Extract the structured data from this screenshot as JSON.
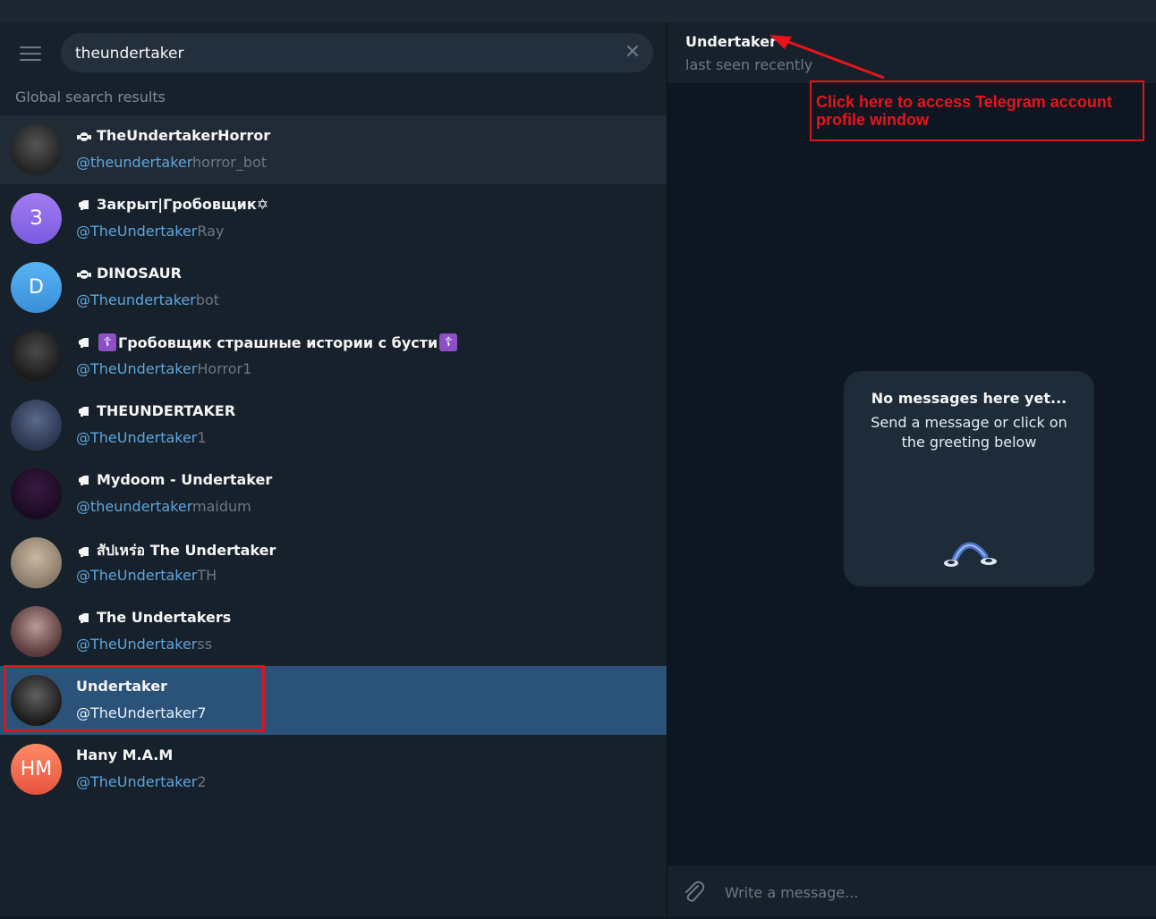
{
  "search": {
    "value": "theundertaker",
    "clear_label": "✕"
  },
  "section_label": "Global search results",
  "results": [
    {
      "title": "TheUndertakerHorror",
      "kind": "bot",
      "handle_match": "@theundertaker",
      "handle_rest": "horror_bot",
      "avatar_type": "photo",
      "avatar_colors": [
        "#222",
        "#555"
      ]
    },
    {
      "title": "Закрыт|Гробовщик✡",
      "kind": "channel",
      "handle_match": "@TheUndertaker",
      "handle_rest": "Ray",
      "avatar_type": "letter",
      "avatar_letter": "З",
      "avatar_colors": [
        "#a17cf0",
        "#7b5be0"
      ]
    },
    {
      "title": "DINOSAUR",
      "kind": "bot",
      "handle_match": "@Theundertaker",
      "handle_rest": "bot",
      "avatar_type": "letter",
      "avatar_letter": "D",
      "avatar_colors": [
        "#58b3f5",
        "#3a8fd8"
      ]
    },
    {
      "title_before": "",
      "title_mid": "Гробовщик страшные истории с бусти",
      "kind": "channel",
      "badge": "☦",
      "handle_match": "@TheUndertaker",
      "handle_rest": "Horror1",
      "avatar_type": "photo",
      "avatar_colors": [
        "#1a1a1a",
        "#4a4a4a"
      ]
    },
    {
      "title": "THEUNDERTAKER",
      "kind": "channel",
      "handle_match": "@TheUndertaker",
      "handle_rest": "1",
      "avatar_type": "photo",
      "avatar_colors": [
        "#2a3550",
        "#5a6a8a"
      ]
    },
    {
      "title": "Mydoom - Undertaker",
      "kind": "channel",
      "handle_match": "@theundertaker",
      "handle_rest": "maidum",
      "avatar_type": "photo",
      "avatar_colors": [
        "#1a0a22",
        "#3a1a44"
      ]
    },
    {
      "title": "สัปเหร่อ The Undertaker",
      "kind": "channel",
      "handle_match": "@TheUndertaker",
      "handle_rest": "TH",
      "avatar_type": "photo",
      "avatar_colors": [
        "#8a7a6a",
        "#c9b9a0"
      ]
    },
    {
      "title": "The Undertakers",
      "kind": "channel",
      "handle_match": "@TheUndertaker",
      "handle_rest": "ss",
      "avatar_type": "photo",
      "avatar_colors": [
        "#5a3a3a",
        "#b89a9a"
      ]
    },
    {
      "title": "Undertaker",
      "kind": "user",
      "handle_match": "@TheUndertaker7",
      "handle_rest": "",
      "avatar_type": "photo",
      "avatar_colors": [
        "#1a1a1a",
        "#606060"
      ]
    },
    {
      "title": "Hany M.A.M",
      "kind": "user",
      "handle_match": "@TheUndertaker",
      "handle_rest": "2",
      "avatar_type": "letter",
      "avatar_letter": "HM",
      "avatar_colors": [
        "#ff8a65",
        "#e5533d"
      ]
    }
  ],
  "chat": {
    "title": "Undertaker",
    "status": "last seen recently",
    "empty_title": "No messages here yet...",
    "empty_text": "Send a message or click on the greeting below",
    "composer_placeholder": "Write a message..."
  },
  "annotation": {
    "text": "Click here to access Telegram account profile window",
    "color": "#e8141c"
  },
  "colors": {
    "accent": "#5fa6db",
    "selected_row": "#2b5278",
    "panel": "#17212b",
    "background": "#0e1621"
  }
}
